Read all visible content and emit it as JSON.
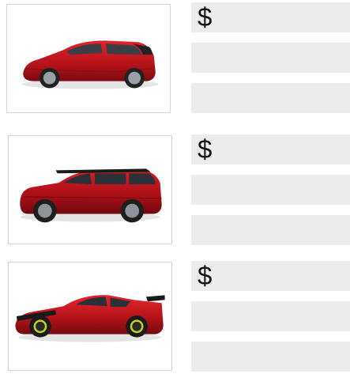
{
  "currency_symbol": "$",
  "colors": {
    "field_bg": "#ececec",
    "card_border": "#d4d4d4",
    "car_red": "#c0161c"
  },
  "listings": [
    {
      "vehicle_icon": "hatchback-car-image",
      "price": "",
      "field_2": "",
      "field_3": ""
    },
    {
      "vehicle_icon": "suv-car-image",
      "price": "",
      "field_2": "",
      "field_3": ""
    },
    {
      "vehicle_icon": "sports-car-image",
      "price": "",
      "field_2": "",
      "field_3": ""
    }
  ]
}
